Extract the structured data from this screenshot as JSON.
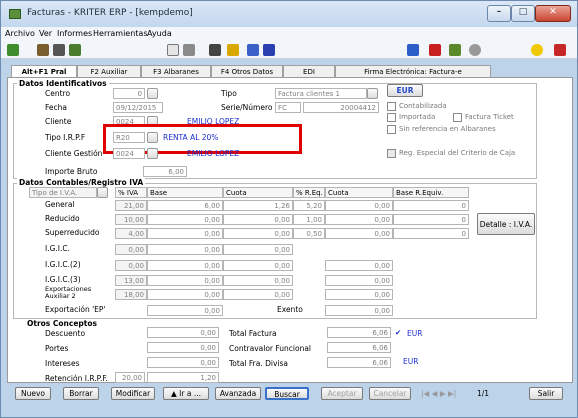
{
  "window": {
    "title": "Facturas - KRITER ERP - [kempdemo]"
  },
  "menu": [
    "Archivo",
    "Ver",
    "Informes",
    "Herramientas",
    "Ayuda"
  ],
  "tabs": [
    "Alt+F1 Pral",
    "F2 Auxiliar",
    "F3 Albaranes",
    "F4 Otros Datos",
    "EDI",
    "Firma Electrónica: Factura-e"
  ],
  "identificativos": {
    "section": "Datos Identificativos",
    "centro_label": "Centro",
    "centro_value": "0",
    "tipo_label": "Tipo",
    "tipo_value": "Factura clientes 1",
    "fecha_label": "Fecha",
    "fecha_value": "09/12/2015",
    "serie_label": "Serie/Número",
    "serie_value": "FC",
    "numero_value": "20004412",
    "cliente_label": "Cliente",
    "cliente_code": "0024",
    "cliente_name": "EMILIO LOPEZ",
    "irpf_label": "Tipo I.R.P.F",
    "irpf_code": "R20",
    "irpf_desc": "RENTA AL 20%",
    "gestion_label": "Cliente Gestión",
    "gestion_code": "0024",
    "gestion_name": "EMILIO LOPEZ",
    "importe_label": "Importe Bruto",
    "importe_value": "6,00",
    "currency": "EUR",
    "contabilizada": "Contabilizada",
    "importada": "Importada",
    "factura_ticket": "Factura Ticket",
    "sin_ref": "Sin referencia en Albaranes",
    "reg_especial": "Reg. Especial del Criterio de Caja"
  },
  "iva": {
    "section": "Datos Contables/Registro IVA",
    "tipo_placeholder": "Tipo de I.V.A.",
    "headers": [
      "% IVA",
      "Base",
      "Cuota",
      "% R.Eq.",
      "Cuota",
      "Base R.Equiv."
    ],
    "rows": [
      {
        "label": "General",
        "pct": "21,00",
        "base": "6,00",
        "cuota": "1,26",
        "req": "5,20",
        "cuota2": "0,00",
        "bre": "0"
      },
      {
        "label": "Reducido",
        "pct": "10,00",
        "base": "0,00",
        "cuota": "0,00",
        "req": "1,00",
        "cuota2": "0,00",
        "bre": "0"
      },
      {
        "label": "Superreducido",
        "pct": "4,00",
        "base": "0,00",
        "cuota": "0,00",
        "req": "0,50",
        "cuota2": "0,00",
        "bre": "0"
      },
      {
        "label": "I.G.I.C.",
        "pct": "0,00",
        "base": "0,00",
        "cuota": "0,00",
        "req": "",
        "cuota2": "",
        "bre": ""
      },
      {
        "label": "I.G.I.C.(2)",
        "pct": "0,00",
        "base": "0,00",
        "cuota": "0,00",
        "req": "",
        "cuota2": "0,00",
        "bre": ""
      },
      {
        "label": "I.G.I.C.(3)",
        "pct": "13,00",
        "base": "0,00",
        "cuota": "0,00",
        "req": "",
        "cuota2": "0,00",
        "bre": ""
      },
      {
        "label": "Exportaciones Auxiliar 2",
        "pct": "18,00",
        "base": "0,00",
        "cuota": "0,00",
        "req": "",
        "cuota2": "0,00",
        "bre": ""
      },
      {
        "label": "Exportación 'EP'",
        "pct": "",
        "base": "0,00",
        "cuota": "Exento",
        "req": "",
        "cuota2": "0,00",
        "bre": ""
      }
    ],
    "detalle_button": "Detalle : I.V.A."
  },
  "otros": {
    "section": "Otros Conceptos",
    "descuento_label": "Descuento",
    "descuento_value": "0,00",
    "portes_label": "Portes",
    "portes_value": "0,00",
    "intereses_label": "Intereses",
    "intereses_value": "0,00",
    "retencion_label": "Retención I.R.P.F.",
    "retencion_pct": "20,00",
    "retencion_value": "1,20",
    "total_factura_label": "Total Factura",
    "total_factura_value": "6,06",
    "total_factura_cur": "EUR",
    "contravalor_label": "Contravalor Funcional",
    "contravalor_value": "6,06",
    "total_divisa_label": "Total Fra. Divisa",
    "total_divisa_value": "6,06",
    "total_divisa_cur": "EUR"
  },
  "buttons": {
    "nuevo": "Nuevo",
    "borrar": "Borrar",
    "modificar": "Modificar",
    "ira": "Ir a ...",
    "avanzada": "Avanzada",
    "buscar": "Buscar",
    "aceptar": "Aceptar",
    "cancelar": "Cancelar",
    "page": "1/1",
    "salir": "Salir"
  }
}
